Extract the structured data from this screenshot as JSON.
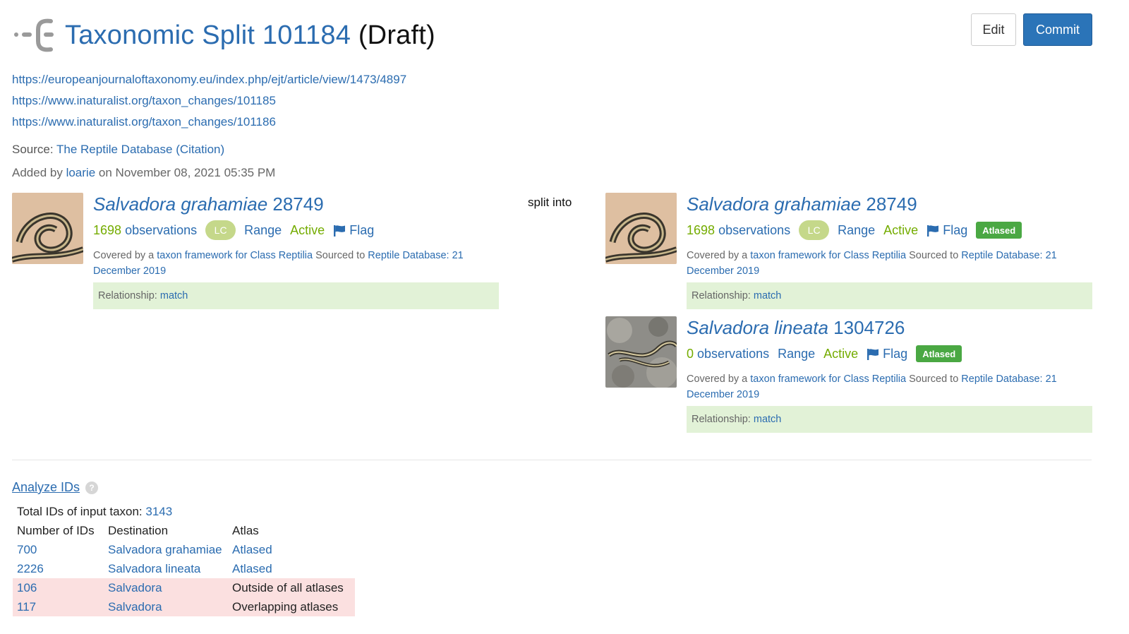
{
  "header": {
    "title_link": "Taxonomic Split 101184",
    "title_status": "(Draft)",
    "logo_icon": "taxon-change-split-icon"
  },
  "actions": {
    "edit_label": "Edit",
    "commit_label": "Commit",
    "commit_color": "#2b74b8"
  },
  "links": [
    "https://europeanjournaloftaxonomy.eu/index.php/ejt/article/view/1473/4897",
    "https://www.inaturalist.org/taxon_changes/101185",
    "https://www.inaturalist.org/taxon_changes/101186"
  ],
  "source": {
    "label": "Source:",
    "name": "The Reptile Database",
    "citation": "(Citation)"
  },
  "added": {
    "prefix": "Added by",
    "user": "loarie",
    "date": "on November 08, 2021 05:35 PM"
  },
  "split_label": "split into",
  "input_taxon": {
    "name": "Salvadora grahamiae",
    "id": "28749",
    "obs_count": "1698",
    "obs_label": "observations",
    "status": "LC",
    "range_label": "Range",
    "active_label": "Active",
    "flag_label": "Flag",
    "covered_prefix": "Covered by a",
    "framework_link": "taxon framework for Class Reptilia",
    "sourced_text": "Sourced to",
    "source_link": "Reptile Database: 21 December 2019",
    "rel_label": "Relationship:",
    "rel_value": "match"
  },
  "output_taxa": [
    {
      "name": "Salvadora grahamiae",
      "id": "28749",
      "obs_count": "1698",
      "obs_label": "observations",
      "status": "LC",
      "range_label": "Range",
      "active_label": "Active",
      "flag_label": "Flag",
      "atlased_label": "Atlased",
      "covered_prefix": "Covered by a",
      "framework_link": "taxon framework for Class Reptilia",
      "sourced_text": "Sourced to",
      "source_link": "Reptile Database: 21 December 2019",
      "rel_label": "Relationship:",
      "rel_value": "match"
    },
    {
      "name": "Salvadora lineata",
      "id": "1304726",
      "obs_count": "0",
      "obs_label": "observations",
      "range_label": "Range",
      "active_label": "Active",
      "flag_label": "Flag",
      "atlased_label": "Atlased",
      "covered_prefix": "Covered by a",
      "framework_link": "taxon framework for Class Reptilia",
      "sourced_text": "Sourced to",
      "source_link": "Reptile Database: 21 December 2019",
      "rel_label": "Relationship:",
      "rel_value": "match"
    }
  ],
  "analyze": {
    "link_label": "Analyze IDs",
    "help_icon": "question-circle-icon",
    "total_label": "Total IDs of input taxon:",
    "total_value": "3143",
    "columns": [
      "Number of IDs",
      "Destination",
      "Atlas"
    ],
    "rows": [
      {
        "count": "700",
        "destination": "Salvadora grahamiae",
        "atlas": "Atlased",
        "atlas_linked": true,
        "warn": false
      },
      {
        "count": "2226",
        "destination": "Salvadora lineata",
        "atlas": "Atlased",
        "atlas_linked": true,
        "warn": false
      },
      {
        "count": "106",
        "destination": "Salvadora",
        "atlas": "Outside of all atlases",
        "atlas_linked": false,
        "warn": true
      },
      {
        "count": "117",
        "destination": "Salvadora",
        "atlas": "Overlapping atlases",
        "atlas_linked": false,
        "warn": true
      }
    ]
  },
  "colors": {
    "link": "#2b6cb0",
    "olive": "#74ac00",
    "relationship_bg": "#e2f2d7",
    "atlased_badge": "#4aa843",
    "warn_row": "#fbe0e0"
  }
}
